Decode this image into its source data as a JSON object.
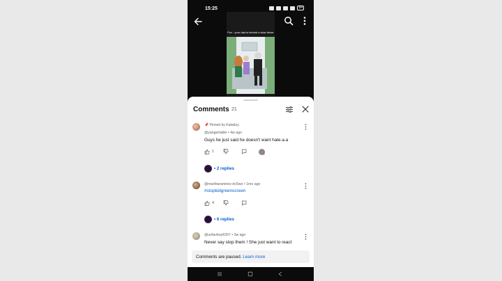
{
  "status": {
    "time": "15:25",
    "battery": "84"
  },
  "video": {
    "caption": "Pov : your dad is behind a slow driver"
  },
  "comments": {
    "title": "Comments",
    "count": "21",
    "items": [
      {
        "pinned_label": "Pinned by Kate&zy",
        "author": "@yangertable",
        "time": "4w ago",
        "text": "Guys he just said he doesn't want hate.a.a",
        "likes": "1",
        "replies_label": "• 2 replies"
      },
      {
        "author": "@martharamirez-dc5wo",
        "time": "1mo ago",
        "text": "#stopkidgreenscreen",
        "likes": "4",
        "replies_label": "• 6 replies"
      },
      {
        "author": "@unfavboy6357",
        "time": "3w ago",
        "text": "Never say stop them ! She just want to react"
      }
    ],
    "paused_text": "Comments are paused.",
    "learn_more": "Learn more"
  },
  "colors": {
    "link": "#065fd4",
    "sheet_bg": "#ffffff",
    "phone_bg": "#0b0b0b"
  },
  "icons": [
    "back-arrow-icon",
    "search-icon",
    "more-vert-icon",
    "filter-icon",
    "close-icon",
    "thumb-up-icon",
    "thumb-down-icon",
    "reply-icon"
  ]
}
